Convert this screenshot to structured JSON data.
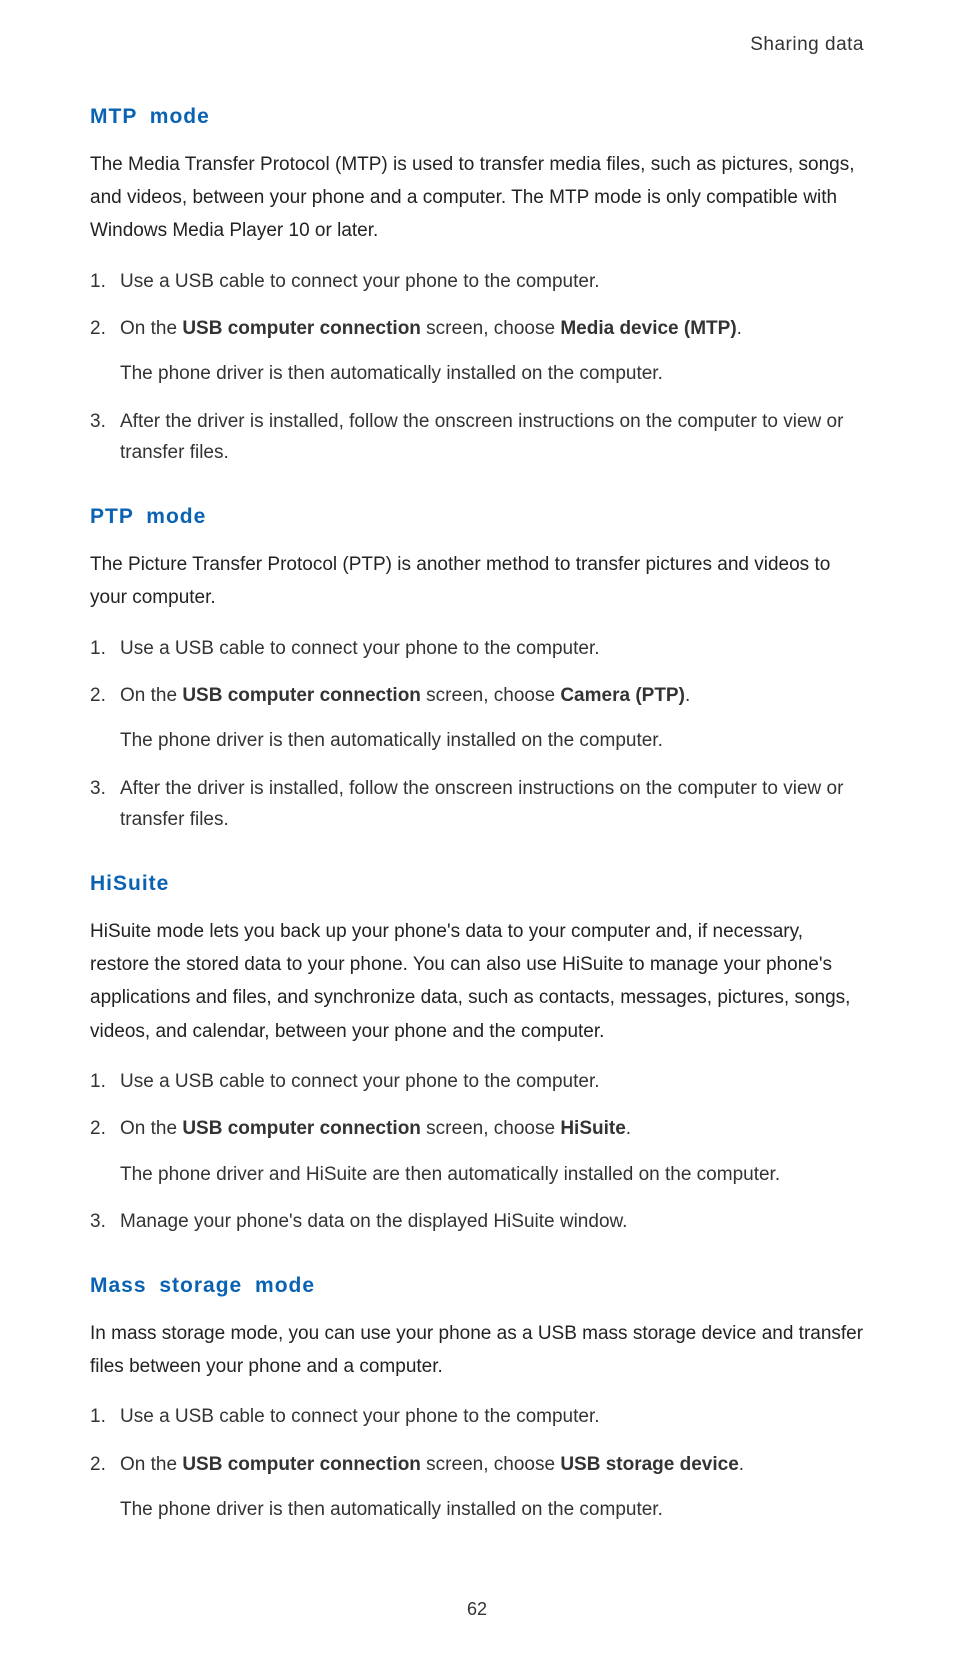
{
  "header": {
    "title": "Sharing data"
  },
  "sections": [
    {
      "heading": "MTP  mode",
      "body": "The Media Transfer Protocol (MTP) is used to transfer media files, such as pictures, songs, and videos, between your phone and a computer. The MTP mode is only compatible with Windows Media Player 10 or later.",
      "steps": [
        {
          "pre": "Use a USB cable to connect your phone to the computer."
        },
        {
          "pre": "On the ",
          "bold1": "USB computer connection",
          "mid": " screen, choose ",
          "bold2": "Media device (MTP)",
          "post": ".",
          "sub": "The phone driver is then automatically installed on the computer."
        },
        {
          "pre": "After the driver is installed, follow the onscreen instructions on the computer to view or transfer files."
        }
      ]
    },
    {
      "heading": "PTP  mode",
      "body": "The Picture Transfer Protocol (PTP) is another method to transfer pictures and videos to your computer.",
      "steps": [
        {
          "pre": "Use a USB cable to connect your phone to the computer."
        },
        {
          "pre": "On the ",
          "bold1": "USB computer connection",
          "mid": " screen, choose ",
          "bold2": "Camera (PTP)",
          "post": ".",
          "sub": "The phone driver is then automatically installed on the computer."
        },
        {
          "pre": "After the driver is installed, follow the onscreen instructions on the computer to view or transfer files."
        }
      ]
    },
    {
      "heading": "HiSuite",
      "body": "HiSuite mode lets you back up your phone's data to your computer and, if necessary, restore the stored data to your phone. You can also use HiSuite to manage your phone's applications and files, and synchronize data, such as contacts, messages, pictures, songs, videos, and calendar, between your phone and the computer.",
      "steps": [
        {
          "pre": "Use a USB cable to connect your phone to the computer."
        },
        {
          "pre": "On the ",
          "bold1": "USB computer connection",
          "mid": " screen, choose ",
          "bold2": "HiSuite",
          "post": ".",
          "sub": "The phone driver and HiSuite are then automatically installed on the computer."
        },
        {
          "pre": "Manage your phone's data on the displayed HiSuite window."
        }
      ]
    },
    {
      "heading": "Mass  storage  mode",
      "body": "In mass storage mode, you can use your phone as a USB mass storage device and transfer files between your phone and a computer.",
      "steps": [
        {
          "pre": "Use a USB cable to connect your phone to the computer."
        },
        {
          "pre": "On the ",
          "bold1": "USB computer connection",
          "mid": " screen, choose ",
          "bold2": "USB storage device",
          "post": ".",
          "sub": "The phone driver is then automatically installed on the computer."
        }
      ]
    }
  ],
  "page_number": "62"
}
